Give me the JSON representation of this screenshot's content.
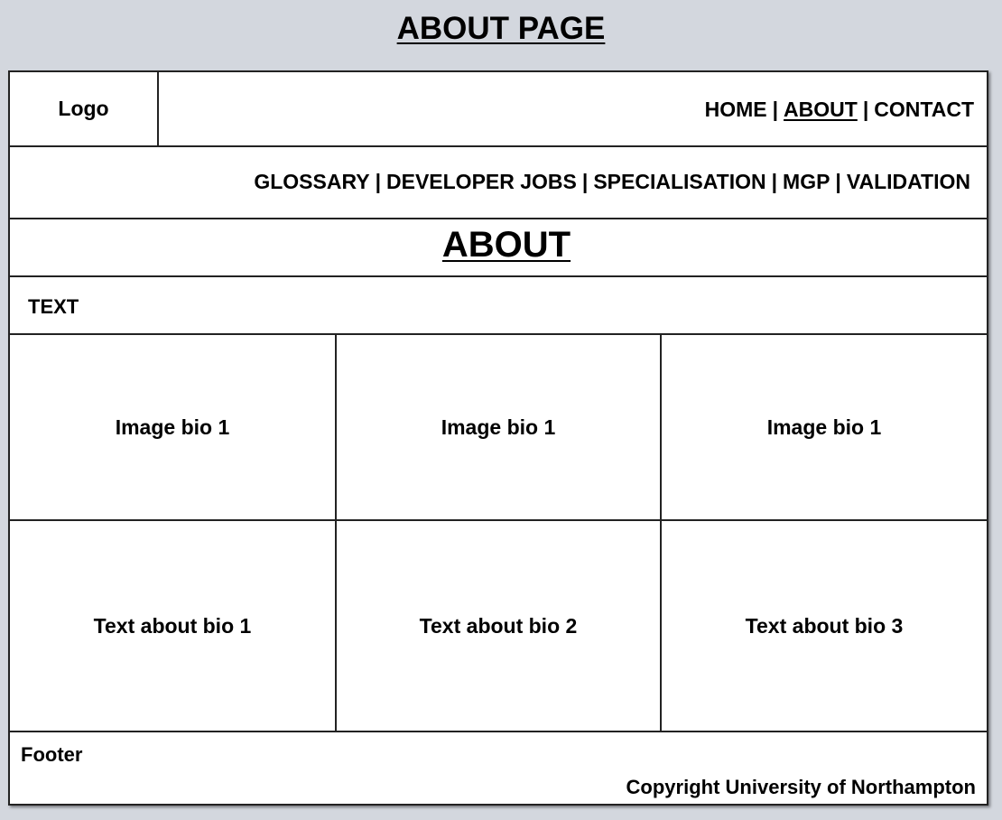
{
  "page_title": "ABOUT PAGE",
  "header": {
    "logo": "Logo",
    "nav_primary": [
      {
        "label": "HOME",
        "active": false
      },
      {
        "label": "ABOUT",
        "active": true
      },
      {
        "label": "CONTACT",
        "active": false
      }
    ],
    "separator": "|"
  },
  "nav_secondary": [
    "GLOSSARY",
    "DEVELOPER JOBS",
    "SPECIALISATION",
    "MGP",
    "VALIDATION"
  ],
  "section_heading": "ABOUT",
  "text_block": "TEXT",
  "bios": {
    "images": [
      "Image bio 1",
      "Image bio 1",
      "Image bio 1"
    ],
    "texts": [
      "Text about bio 1",
      "Text about bio 2",
      "Text about bio 3"
    ]
  },
  "footer": {
    "label": "Footer",
    "copyright": "Copyright University of Northampton"
  }
}
